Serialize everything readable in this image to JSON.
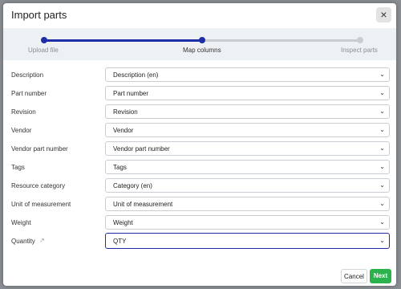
{
  "dialog": {
    "title": "Import parts",
    "close_symbol": "×"
  },
  "stepper": {
    "steps": [
      {
        "label": "Upload file",
        "state": "complete"
      },
      {
        "label": "Map columns",
        "state": "current"
      },
      {
        "label": "Inspect parts",
        "state": "upcoming"
      }
    ],
    "colors": {
      "complete": "#1e2ea8",
      "upcoming": "#c8cdd2"
    }
  },
  "mappings": [
    {
      "label": "Description",
      "value": "Description (en)"
    },
    {
      "label": "Part number",
      "value": "Part number"
    },
    {
      "label": "Revision",
      "value": "Revision"
    },
    {
      "label": "Vendor",
      "value": "Vendor"
    },
    {
      "label": "Vendor part number",
      "value": "Vendor part number"
    },
    {
      "label": "Tags",
      "value": "Tags"
    },
    {
      "label": "Resource category",
      "value": "Category (en)"
    },
    {
      "label": "Unit of measurement",
      "value": "Unit of measurement"
    },
    {
      "label": "Weight",
      "value": "Weight"
    },
    {
      "label": "Quantity",
      "value": "QTY",
      "has_link_icon": true,
      "focused": true
    }
  ],
  "icons": {
    "chevron": "chevron-down-icon",
    "link": "external-link-icon"
  },
  "footer": {
    "cancel_label": "Cancel",
    "next_label": "Next",
    "next_color": "#2bb24c"
  }
}
